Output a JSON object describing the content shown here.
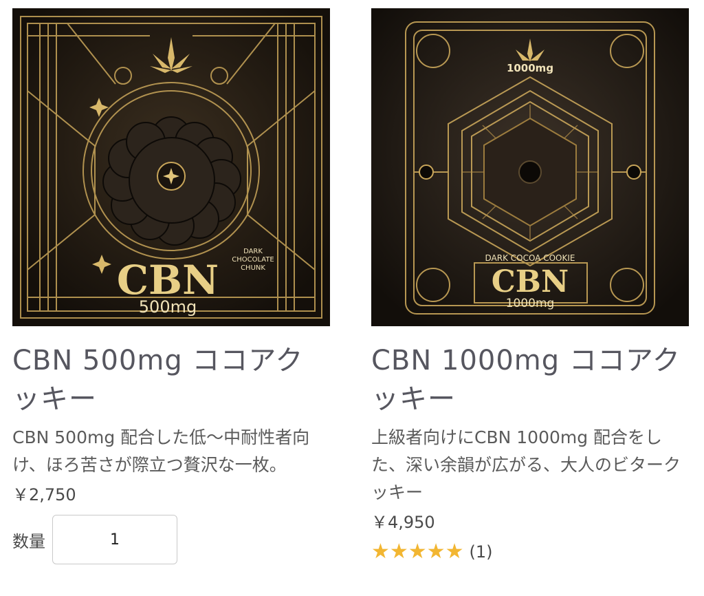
{
  "products": [
    {
      "image": {
        "brand": "CBN",
        "dose": "500mg",
        "flavor_lines": [
          "DARK",
          "CHOCOLATE",
          "CHUNK"
        ]
      },
      "title": "CBN 500mg ココアクッキー",
      "description": "CBN 500mg 配合した低〜中耐性者向け、ほろ苦さが際立つ贅沢な一枚。",
      "price": "￥2,750",
      "quantity_label": "数量",
      "quantity_value": "1"
    },
    {
      "image": {
        "brand": "CBN",
        "dose_top": "1000mg",
        "dose": "1000mg",
        "flavor": "DARK COCOA COOKIE"
      },
      "title": "CBN 1000mg ココアクッキー",
      "description": "上級者向けにCBN 1000mg 配合をした、深い余韻が広がる、大人のビタークッキー",
      "price": "￥4,950",
      "rating": {
        "stars": "★★★★★",
        "value": 5,
        "count": "(1)"
      }
    }
  ],
  "colors": {
    "gold": "#c9a65a",
    "dark": "#1f1912",
    "star": "#f2b632"
  }
}
